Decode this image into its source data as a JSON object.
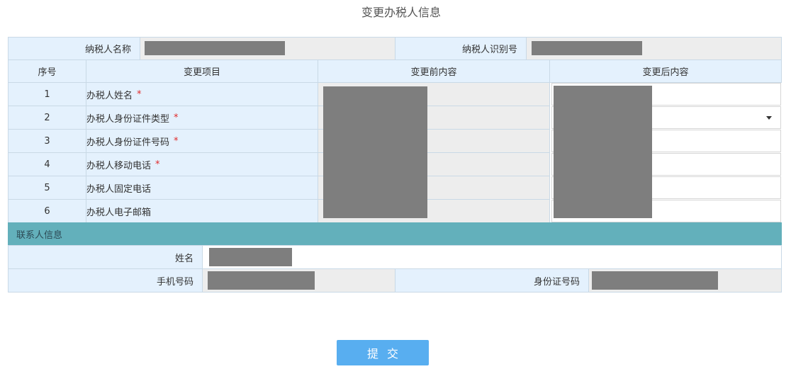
{
  "page_title": "变更办税人信息",
  "header": {
    "taxpayer_name_label": "纳税人名称",
    "taxpayer_id_label": "纳税人识别号"
  },
  "table": {
    "columns": [
      "序号",
      "变更项目",
      "变更前内容",
      "变更后内容"
    ],
    "rows": [
      {
        "no": "1",
        "item": "办税人姓名",
        "required": "*"
      },
      {
        "no": "2",
        "item": "办税人身份证件类型",
        "required": "*"
      },
      {
        "no": "3",
        "item": "办税人身份证件号码",
        "required": "*"
      },
      {
        "no": "4",
        "item": "办税人移动电话",
        "required": "*"
      },
      {
        "no": "5",
        "item": "办税人固定电话",
        "required": ""
      },
      {
        "no": "6",
        "item": "办税人电子邮箱",
        "required": ""
      }
    ]
  },
  "contact": {
    "section_title": "联系人信息",
    "name_label": "姓名",
    "phone_label": "手机号码",
    "id_label": "身份证号码"
  },
  "submit_label": "提交",
  "colors": {
    "label_bg": "#e4f1fd",
    "section_bg": "#63b0bb",
    "button_bg": "#58aef0",
    "redaction": "#7e7e7e"
  }
}
